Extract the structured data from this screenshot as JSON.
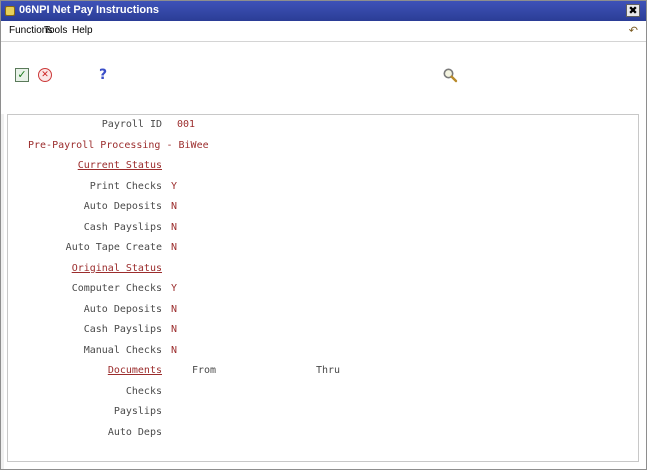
{
  "window": {
    "title": "06NPI  Net Pay Instructions",
    "close_glyph": "✖"
  },
  "menu": {
    "functions": "Functions",
    "tools": "Tools",
    "help": "Help",
    "corner_icon": "↶"
  },
  "toolbar": {
    "ok_icon": "check-icon",
    "cancel_icon": "cancel-icon",
    "help_icon": "help-icon",
    "search_icon": "search-icon",
    "ok_glyph": "✓",
    "cancel_glyph": "✕",
    "help_glyph": "?"
  },
  "form": {
    "payroll_id_label": "Payroll ID",
    "payroll_id_value": "001",
    "process_title": "Pre-Payroll Processing - BiWee",
    "current_status": {
      "header": "Current Status",
      "print_checks_label": "Print Checks",
      "print_checks_value": "Y",
      "auto_deposits_label": "Auto Deposits",
      "auto_deposits_value": "N",
      "cash_payslips_label": "Cash Payslips",
      "cash_payslips_value": "N",
      "auto_tape_create_label": "Auto Tape Create",
      "auto_tape_create_value": "N"
    },
    "original_status": {
      "header": "Original Status",
      "computer_checks_label": "Computer Checks",
      "computer_checks_value": "Y",
      "auto_deposits_label": "Auto Deposits",
      "auto_deposits_value": "N",
      "cash_payslips_label": "Cash Payslips",
      "cash_payslips_value": "N",
      "manual_checks_label": "Manual Checks",
      "manual_checks_value": "N"
    },
    "documents": {
      "header": "Documents",
      "from_label": "From",
      "thru_label": "Thru",
      "checks_label": "Checks",
      "payslips_label": "Payslips",
      "auto_deps_label": "Auto Deps"
    }
  },
  "colors": {
    "titlebar": "#2b3d96",
    "value_red": "#9b2c2c",
    "label_gray": "#4a4a4a"
  }
}
